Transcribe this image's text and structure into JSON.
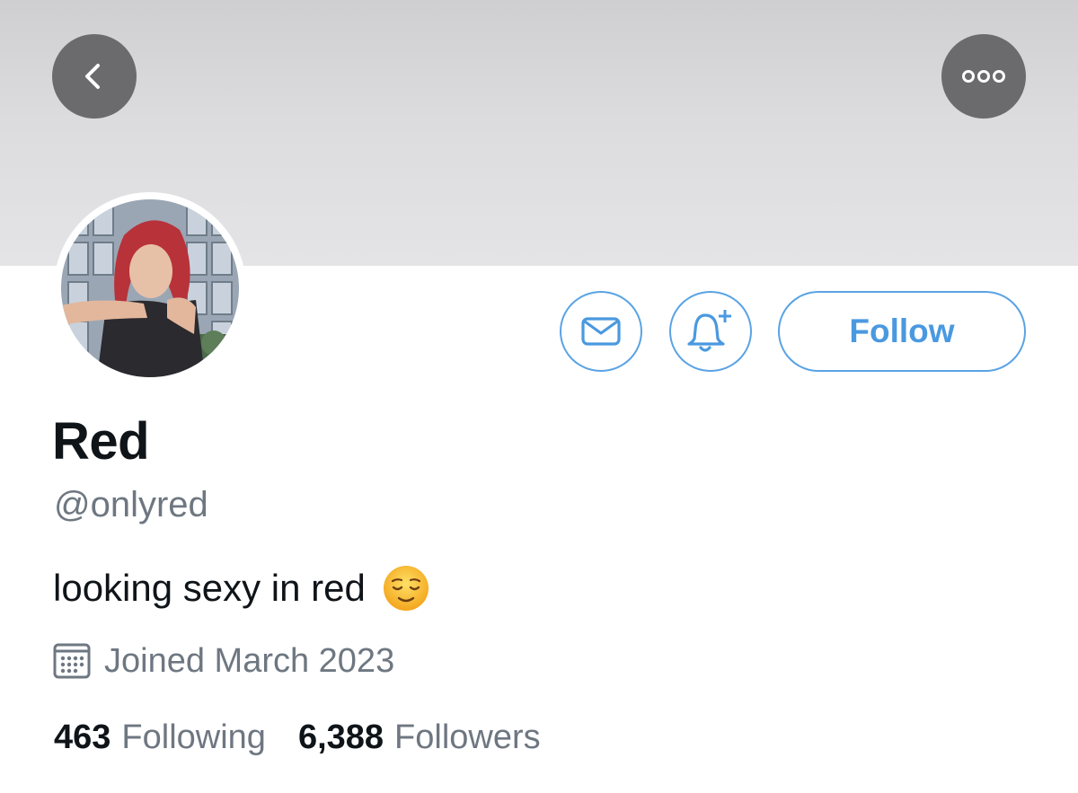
{
  "profile": {
    "name": "Red",
    "handle": "@onlyred",
    "bio": "looking sexy in red",
    "bio_emoji": "relieved-face-emoji",
    "joined": "Joined March 2023"
  },
  "actions": {
    "follow_label": "Follow",
    "message_icon": "envelope-icon",
    "notify_icon": "bell-plus-icon"
  },
  "nav": {
    "back_icon": "chevron-left-icon",
    "more_icon": "ellipsis-icon"
  },
  "stats": {
    "following_count": "463",
    "following_label": "Following",
    "followers_count": "6,388",
    "followers_label": "Followers"
  },
  "colors": {
    "accent": "#4a99e0",
    "secondary_text": "#6e7781",
    "primary_text": "#0f1419",
    "overlay_button": "#6b6b6e"
  }
}
